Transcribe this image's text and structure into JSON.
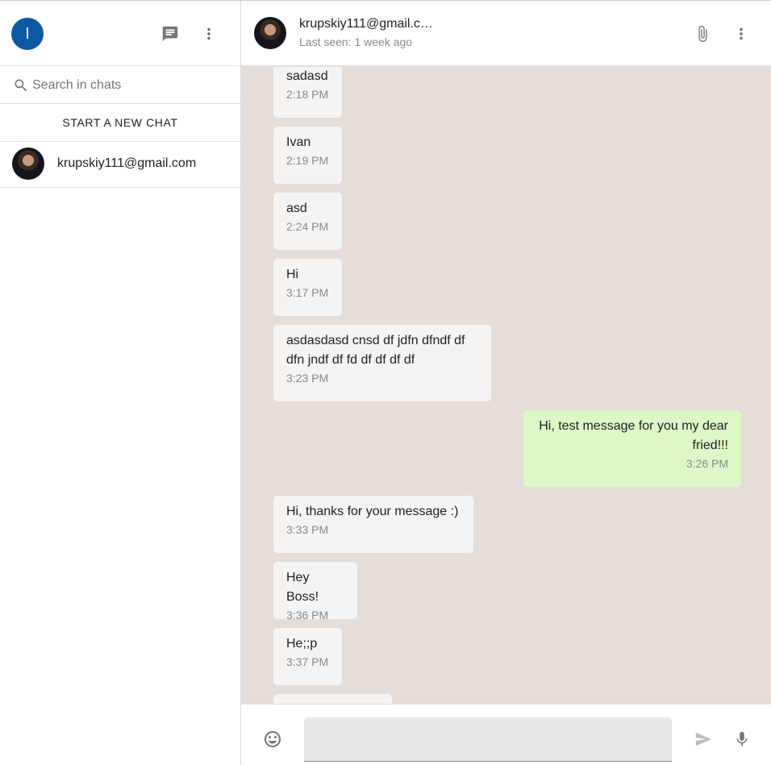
{
  "sidebar": {
    "user_initial": "I",
    "search_placeholder": "Search in chats",
    "new_chat_label": "START A NEW CHAT",
    "chats": [
      {
        "title": "krupskiy111@gmail.com"
      }
    ]
  },
  "chat": {
    "header": {
      "name": "krupskiy111@gmail.c…",
      "status": "Last seen: 1 week ago"
    },
    "messages": [
      {
        "text": "sadasd",
        "time": "2:18 PM",
        "direction": "in"
      },
      {
        "text": "Ivan",
        "time": "2:19 PM",
        "direction": "in"
      },
      {
        "text": "asd",
        "time": "2:24 PM",
        "direction": "in"
      },
      {
        "text": "Hi",
        "time": "3:17 PM",
        "direction": "in"
      },
      {
        "text": "asdasdasd cnsd df jdfn dfndf df dfn jndf df fd df df df df",
        "time": "3:23 PM",
        "direction": "in"
      },
      {
        "text": "Hi, test message for you my dear fried!!!",
        "time": "3:26 PM",
        "direction": "out"
      },
      {
        "text": "Hi, thanks for your message :)",
        "time": "3:33 PM",
        "direction": "in"
      },
      {
        "text": "Hey Boss!",
        "time": "3:36 PM",
        "direction": "in"
      },
      {
        "text": "He;;p",
        "time": "3:37 PM",
        "direction": "in"
      }
    ],
    "composer": {
      "value": ""
    }
  },
  "colors": {
    "avatar_bg": "#0b5aa3",
    "chat_bg": "#e5ddd8",
    "incoming_bubble": "#f4f4f4",
    "outgoing_bubble": "#dcf8c6"
  },
  "icons": {
    "new_chat": "chat-icon",
    "sidebar_menu": "more-vert-icon",
    "search": "search-icon",
    "attach": "paperclip-icon",
    "chat_menu": "more-vert-icon",
    "emoji": "emoji-icon",
    "send": "send-icon",
    "mic": "microphone-icon"
  }
}
